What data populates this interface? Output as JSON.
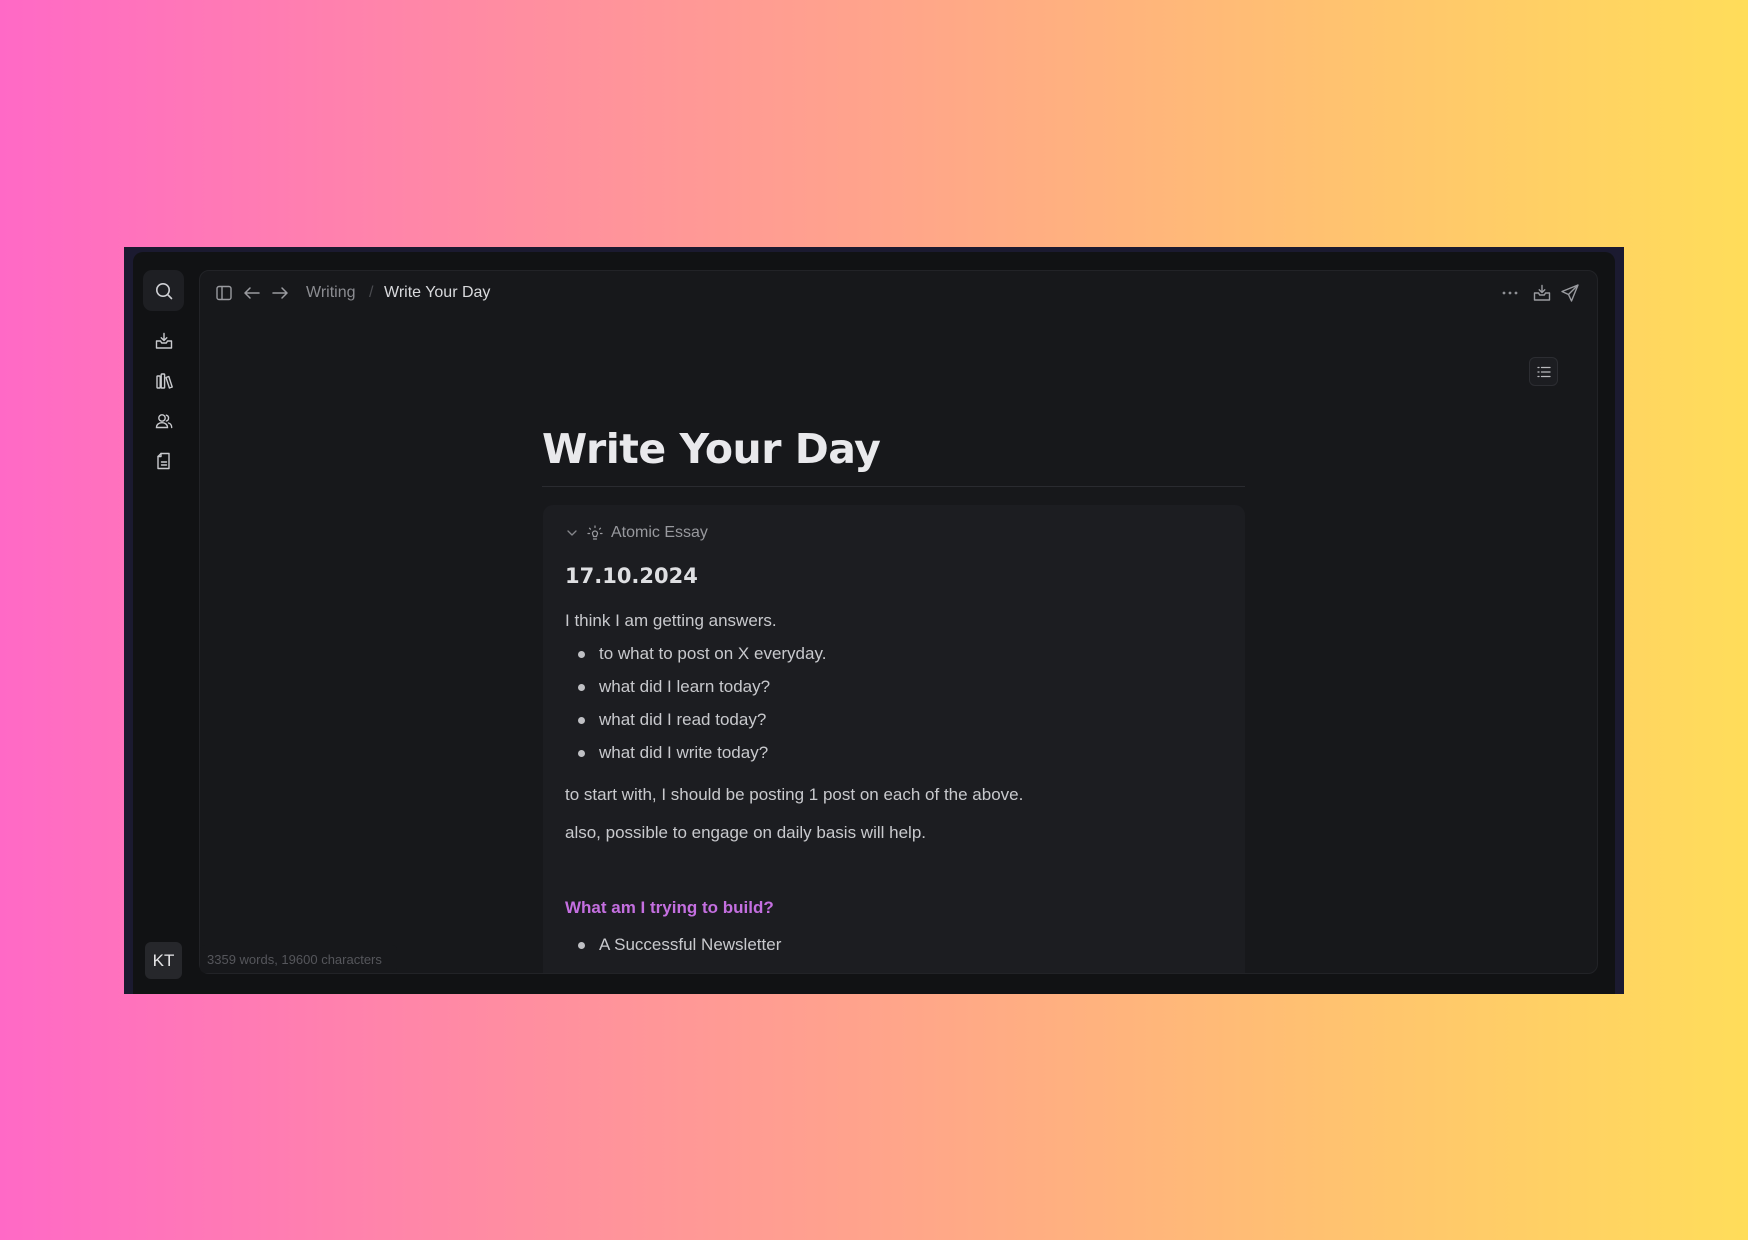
{
  "background": {
    "gradient_start": "#ff69c6",
    "gradient_end": "#ffdd5a"
  },
  "sidebar": {
    "items": [
      {
        "name": "search",
        "icon": "search-icon"
      },
      {
        "name": "import",
        "icon": "inbox-download-icon"
      },
      {
        "name": "library",
        "icon": "library-books-icon"
      },
      {
        "name": "people",
        "icon": "users-icon"
      },
      {
        "name": "documents",
        "icon": "document-icon"
      }
    ],
    "avatar_initials": "KT"
  },
  "topbar": {
    "breadcrumb": {
      "parent": "Writing",
      "separator": "/",
      "current": "Write Your Day"
    },
    "actions": [
      {
        "name": "more",
        "icon": "ellipsis-icon"
      },
      {
        "name": "import",
        "icon": "inbox-download-icon"
      },
      {
        "name": "publish",
        "icon": "send-icon"
      }
    ]
  },
  "document": {
    "title": "Write Your Day",
    "callout": {
      "label": "Atomic Essay",
      "icon": "lightbulb-icon",
      "date": "17.10.2024",
      "intro": "I think I am getting answers.",
      "bullets": [
        "to what to post on X everyday.",
        "what did I learn today?",
        "what did I read today?",
        "what did I write today?"
      ],
      "para1": "to start with, I should be posting 1 post on each of the above.",
      "para2": "also, possible to engage on daily basis will help.",
      "heading": "What am I trying to build?",
      "heading_color": "#c46fe0",
      "bullets2": [
        "A Successful Newsletter"
      ]
    }
  },
  "status": {
    "word_count": "3359 words, 19600 characters"
  }
}
